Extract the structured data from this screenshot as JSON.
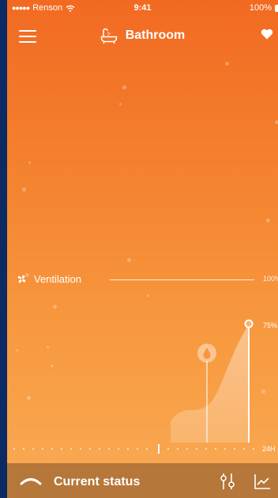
{
  "status_bar": {
    "carrier": "Renson",
    "time": "9:41",
    "battery": "100%"
  },
  "header": {
    "title": "Bathroom"
  },
  "ventilation": {
    "label": "Ventilation",
    "max_label": "100%",
    "current_label": "75%",
    "current_level": 0.75
  },
  "timeline": {
    "end_label": "24H"
  },
  "bottom_bar": {
    "label": "Current status"
  },
  "icons": [
    "menu-icon",
    "bathtub-icon",
    "heart-icon",
    "fan-icon",
    "humidity-drop-icon",
    "chevron-up-icon",
    "sliders-icon",
    "line-chart-icon",
    "wifi-icon",
    "battery-icon"
  ],
  "colors": {
    "background_top": "#f26a22",
    "background_bottom": "#f9ab55",
    "frame": "#0c2a63",
    "text": "#ffffff"
  }
}
